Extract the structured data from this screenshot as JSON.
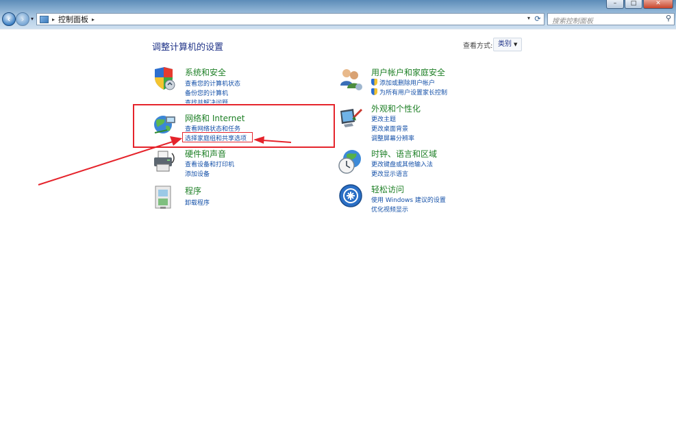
{
  "window": {
    "min_glyph": "–",
    "max_glyph": "□",
    "close_glyph": "✕"
  },
  "address": {
    "breadcrumb": "控制面板",
    "search_placeholder": "搜索控制面板"
  },
  "content": {
    "title": "调整计算机的设置",
    "view_by_label": "查看方式:",
    "view_by_value": "类别"
  },
  "categories": {
    "system": {
      "title": "系统和安全",
      "links": [
        "查看您的计算机状态",
        "备份您的计算机",
        "查找并解决问题"
      ]
    },
    "user": {
      "title": "用户帐户和家庭安全",
      "links": [
        "添加或删除用户帐户",
        "为所有用户设置家长控制"
      ]
    },
    "network": {
      "title": "网络和 Internet",
      "links": [
        "查看网络状态和任务",
        "选择家庭组和共享选项"
      ]
    },
    "appearance": {
      "title": "外观和个性化",
      "links": [
        "更改主题",
        "更改桌面背景",
        "调整屏幕分辨率"
      ]
    },
    "hardware": {
      "title": "硬件和声音",
      "links": [
        "查看设备和打印机",
        "添加设备"
      ]
    },
    "clock": {
      "title": "时钟、语言和区域",
      "links": [
        "更改键盘或其他输入法",
        "更改显示语言"
      ]
    },
    "programs": {
      "title": "程序",
      "links": [
        "卸载程序"
      ]
    },
    "ease": {
      "title": "轻松访问",
      "links": [
        "使用 Windows 建议的设置",
        "优化视频显示"
      ]
    }
  },
  "colors": {
    "category_title": "#1d7f25",
    "link": "#1450a8",
    "heading": "#1e3287",
    "annotation": "#e5232b"
  }
}
